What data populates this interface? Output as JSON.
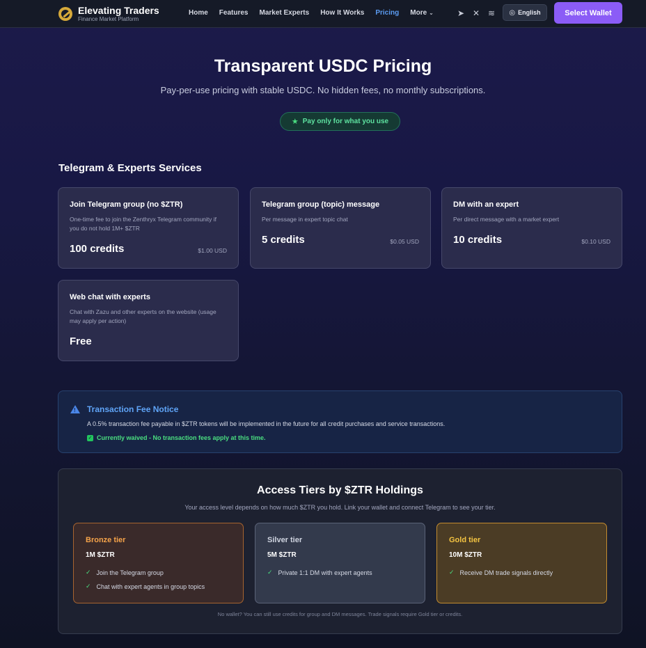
{
  "nav": {
    "brand_title": "Elevating Traders",
    "brand_sub": "Finance Market Platform",
    "links": [
      "Home",
      "Features",
      "Market Experts",
      "How It Works",
      "Pricing",
      "More"
    ],
    "active_link": "Pricing",
    "language": "English",
    "wallet_button": "Select Wallet",
    "icons": [
      "telegram-icon",
      "x-icon",
      "layers-icon"
    ]
  },
  "hero": {
    "title": "Transparent USDC Pricing",
    "subtitle": "Pay-per-use pricing with stable USDC. No hidden fees, no monthly subscriptions.",
    "pill": "Pay only for what you use"
  },
  "services": {
    "title": "Telegram & Experts Services",
    "cards": [
      {
        "title": "Join Telegram group (no $ZTR)",
        "desc": "One-time fee to join the Zenthryx Telegram community if you do not hold 1M+ $ZTR",
        "credits": "100 credits",
        "usd": "$1.00 USD"
      },
      {
        "title": "Telegram group (topic) message",
        "desc": "Per message in expert topic chat",
        "credits": "5 credits",
        "usd": "$0.05 USD"
      },
      {
        "title": "DM with an expert",
        "desc": "Per direct message with a market expert",
        "credits": "10 credits",
        "usd": "$0.10 USD"
      },
      {
        "title": "Web chat with experts",
        "desc": "Chat with Zazu and other experts on the website (usage may apply per action)",
        "credits": "Free",
        "usd": ""
      }
    ]
  },
  "notice": {
    "title": "Transaction Fee Notice",
    "text": "A 0.5% transaction fee payable in $ZTR tokens will be implemented in the future for all credit purchases and service transactions.",
    "waived": "Currently waived - No transaction fees apply at this time."
  },
  "tiers": {
    "title": "Access Tiers by $ZTR Holdings",
    "subtitle": "Your access level depends on how much $ZTR you hold. Link your wallet and connect Telegram to see your tier.",
    "items": [
      {
        "name": "Bronze tier",
        "amount": "1M $ZTR",
        "perks": [
          "Join the Telegram group",
          "Chat with expert agents in group topics"
        ]
      },
      {
        "name": "Silver tier",
        "amount": "5M $ZTR",
        "perks": [
          "Private 1:1 DM with expert agents"
        ]
      },
      {
        "name": "Gold tier",
        "amount": "10M $ZTR",
        "perks": [
          "Receive DM trade signals directly"
        ]
      }
    ],
    "footer": "No wallet? You can still use credits for group and DM messages. Trade signals require Gold tier or credits."
  }
}
